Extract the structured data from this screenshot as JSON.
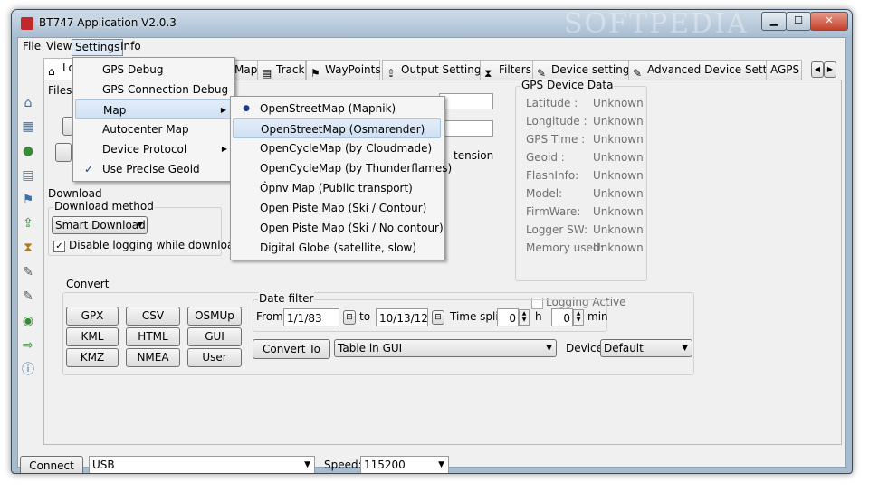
{
  "window": {
    "title": "BT747 Application V2.0.3",
    "watermark": "SOFTPEDIA"
  },
  "menubar": {
    "file": "File",
    "view": "View",
    "settings": "Settings",
    "info": "Info"
  },
  "tabs": {
    "log": "Lo",
    "map": "Map",
    "track": "Track",
    "waypoints": "WayPoints",
    "output": "Output Settings",
    "filters": "Filters",
    "device": "Device settings",
    "advanced": "Advanced Device Settings",
    "agps": "AGPS"
  },
  "files_label": "Files",
  "hidden_text": "tension",
  "download": {
    "group": "Download",
    "method_label": "Download method",
    "method": "Smart Download",
    "disable_logging": "Disable logging while downloading"
  },
  "gps_device": {
    "title": "GPS Device Data",
    "rows": [
      {
        "label": "Latitude :",
        "value": "Unknown"
      },
      {
        "label": "Longitude :",
        "value": "Unknown"
      },
      {
        "label": "GPS Time :",
        "value": "Unknown"
      },
      {
        "label": "Geoid :",
        "value": "Unknown"
      },
      {
        "label": "FlashInfo:",
        "value": "Unknown"
      },
      {
        "label": "Model:",
        "value": "Unknown"
      },
      {
        "label": "FirmWare:",
        "value": "Unknown"
      },
      {
        "label": "Logger SW:",
        "value": "Unknown"
      },
      {
        "label": "Memory used:",
        "value": "Unknown"
      }
    ],
    "logging_active": "Logging Active"
  },
  "convert": {
    "group": "Convert",
    "buttons": [
      "GPX",
      "CSV",
      "OSMUp",
      "KML",
      "HTML",
      "GUI",
      "KMZ",
      "NMEA",
      "User"
    ],
    "date_filter": "Date filter",
    "from_label": "From",
    "from_value": "1/1/83",
    "to_label": "to",
    "to_value": "10/13/12",
    "time_split": "Time split:",
    "h_value": "0",
    "h_label": "h",
    "min_value": "0",
    "min_label": "min",
    "convert_to": "Convert To",
    "format": "Table in GUI",
    "device_label": "Device",
    "device_value": "Default"
  },
  "status": {
    "connect": "Connect",
    "port": "USB",
    "speed_label": "Speed:",
    "speed": "115200"
  },
  "settings_menu": [
    "GPS Debug",
    "GPS Connection Debug",
    "Map",
    "Autocenter Map",
    "Device Protocol",
    "Use Precise Geoid"
  ],
  "map_submenu": [
    "OpenStreetMap (Mapnik)",
    "OpenStreetMap (Osmarender)",
    "OpenCycleMap (by Cloudmade)",
    "OpenCycleMap (by Thunderflames)",
    "Öpnv Map (Public transport)",
    "Open Piste Map (Ski / Contour)",
    "Open Piste Map (Ski / No contour)",
    "Digital Globe (satellite, slow)"
  ],
  "colors": {
    "accent": "#1d3f8a",
    "highlight": "#cfe0f3",
    "title_bar": "#a7bdd2"
  }
}
